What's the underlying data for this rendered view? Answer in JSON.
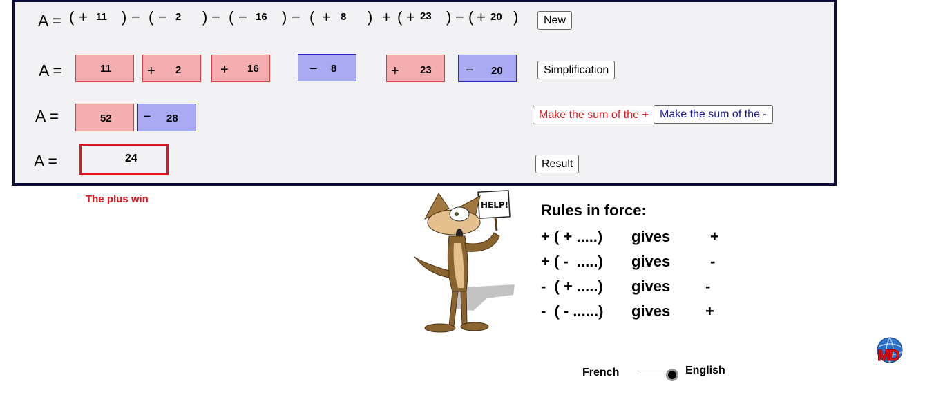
{
  "row1": {
    "label": "A =",
    "tokens": [
      "(",
      "+",
      "11",
      ")",
      "−",
      "(",
      "−",
      "2",
      ")",
      "−",
      "(",
      "−",
      "16",
      ")",
      "−",
      "(",
      "+",
      "8",
      ")",
      "+",
      "(",
      "+",
      "23",
      ")",
      "−",
      "(",
      "+",
      "20",
      ")"
    ],
    "button": "New"
  },
  "row2": {
    "label": "A =",
    "boxes": [
      {
        "sign": "",
        "value": "11",
        "type": "positive"
      },
      {
        "sign": "+",
        "value": "2",
        "type": "positive"
      },
      {
        "sign": "+",
        "value": "16",
        "type": "positive"
      },
      {
        "sign": "−",
        "value": "8",
        "type": "negative"
      },
      {
        "sign": "+",
        "value": "23",
        "type": "positive"
      },
      {
        "sign": "−",
        "value": "20",
        "type": "negative"
      }
    ],
    "button": "Simplification"
  },
  "row3": {
    "label": "A =",
    "boxes": [
      {
        "sign": "",
        "value": "52",
        "type": "positive"
      },
      {
        "sign": "−",
        "value": "28",
        "type": "negative"
      }
    ],
    "sum_plus_button": "Make the sum of the +",
    "sum_minus_button": "Make the sum of the -"
  },
  "row4": {
    "label": "A =",
    "result": "24",
    "button": "Result"
  },
  "message": "The plus win",
  "illustration": {
    "sign_text": "HELP!"
  },
  "rules": {
    "title": "Rules in force:",
    "items": [
      {
        "expr": "+ ( + .....)",
        "gives": "gives",
        "result": "+"
      },
      {
        "expr": "+ ( -  .....)",
        "gives": "gives",
        "result": "-"
      },
      {
        "expr": "-  ( + .....)",
        "gives": "gives",
        "result": "-"
      },
      {
        "expr": "-  ( - ......)",
        "gives": "gives",
        "result": "+"
      }
    ]
  },
  "language": {
    "left": "French",
    "right": "English",
    "selected": "English"
  },
  "logo": {
    "text": "MD"
  },
  "colors": {
    "positive_fill": "#f4aeb0",
    "positive_border": "#e03a3a",
    "negative_fill": "#aaaaf2",
    "negative_border": "#2a2acc",
    "result_border": "#e8141c",
    "message": "#e8141c",
    "sum_plus_text": "#e8141c",
    "sum_minus_text": "#1a1a9e",
    "panel_border": "#0d0d3a"
  }
}
